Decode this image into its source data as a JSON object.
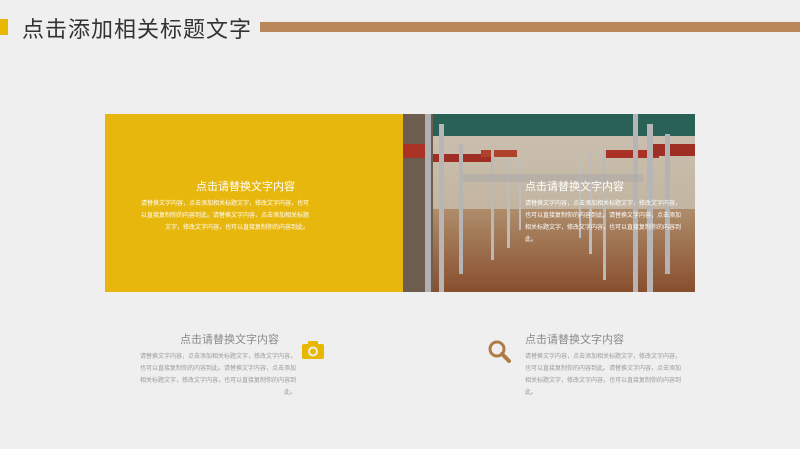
{
  "header": {
    "title": "点击添加相关标题文字"
  },
  "yellow_card": {
    "title": "点击请替换文字内容",
    "body": "请替换文字内容，点击添加相关标题文字，修改文字内容，也可以直接复制你的内容到此。请替换文字内容，点击添加相关标题文字，修改文字内容，也可以直接复制你的内容到此。"
  },
  "photo_card": {
    "title": "点击请替换文字内容",
    "body": "请替换文字内容，点击添加相关标题文字，修改文字内容，也可以直接复制你的内容到此。请替换文字内容，点击添加相关标题文字，修改文字内容，也可以直接复制你的内容到此。"
  },
  "block_left": {
    "title": "点击请替换文字内容",
    "body": "请替换文字内容，点击添加相关标题文字，修改文字内容，也可以直接复制你的内容到此。请替换文字内容，点击添加相关标题文字，修改文字内容，也可以直接复制你的内容到此。",
    "icon": "camera-icon"
  },
  "block_right": {
    "title": "点击请替换文字内容",
    "body": "请替换文字内容，点击添加相关标题文字，修改文字内容，也可以直接复制你的内容到此。请替换文字内容，点击添加相关标题文字，修改文字内容，也可以直接复制你的内容到此。",
    "icon": "search-icon"
  },
  "colors": {
    "accent_yellow": "#e8b70e",
    "title_bar_brown": "#b8875a",
    "icon_yellow": "#e8b800",
    "icon_brown": "#b07a45"
  }
}
